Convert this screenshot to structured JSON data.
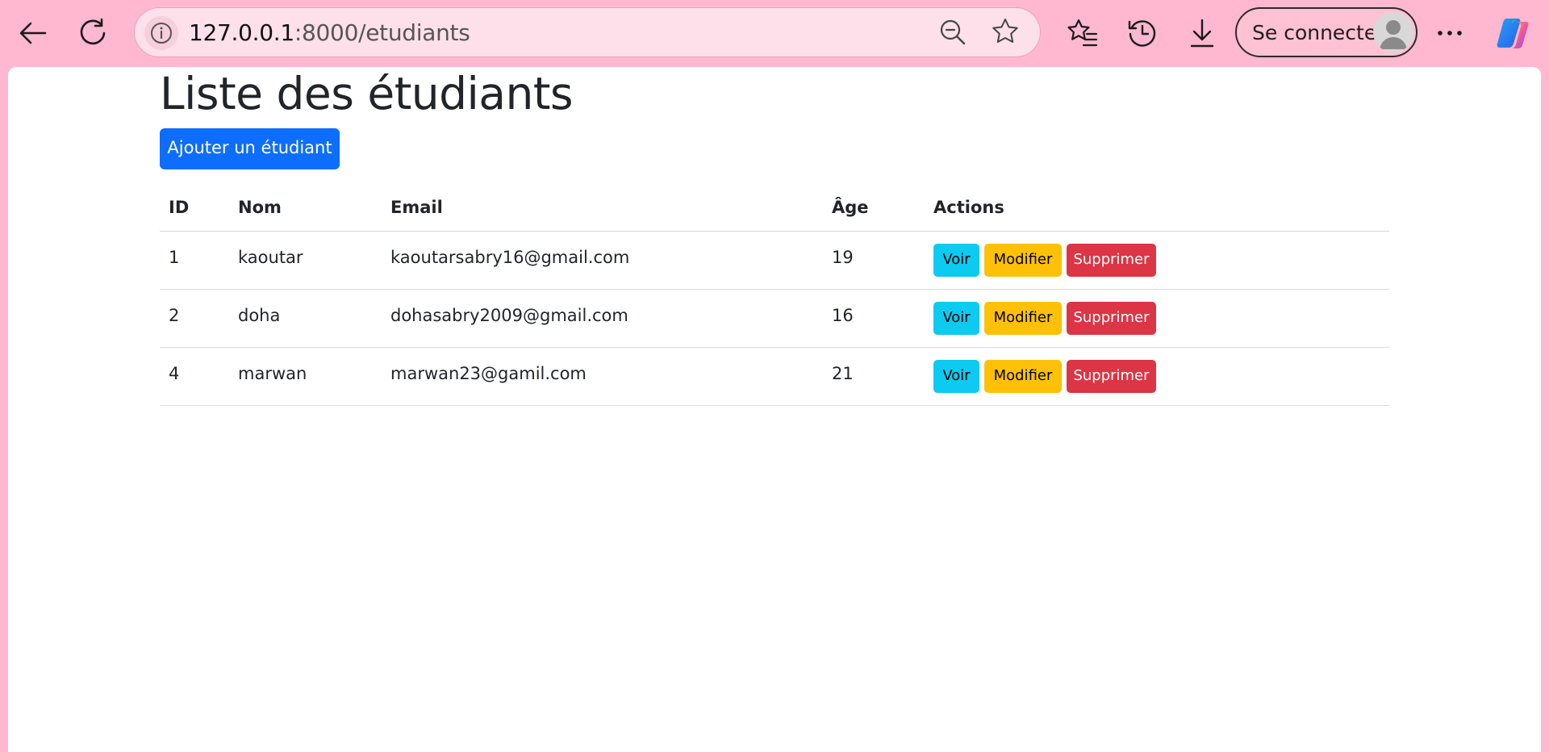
{
  "browser": {
    "url_host": "127.0.0.1",
    "url_rest": ":8000/etudiants",
    "sign_in_label": "Se connecter",
    "icons": [
      "back-icon",
      "refresh-icon",
      "info-icon",
      "zoom-out-icon",
      "favorite-star-icon",
      "favorites-icon",
      "history-icon",
      "download-icon",
      "more-icon",
      "copilot-icon"
    ]
  },
  "page": {
    "title": "Liste des étudiants",
    "add_button": "Ajouter un étudiant"
  },
  "table": {
    "headers": [
      "ID",
      "Nom",
      "Email",
      "Âge",
      "Actions"
    ],
    "rows": [
      {
        "id": "1",
        "nom": "kaoutar",
        "email": "kaoutarsabry16@gmail.com",
        "age": "19"
      },
      {
        "id": "2",
        "nom": "doha",
        "email": "dohasabry2009@gmail.com",
        "age": "16"
      },
      {
        "id": "4",
        "nom": "marwan",
        "email": "marwan23@gamil.com",
        "age": "21"
      }
    ],
    "actions": {
      "view": "Voir",
      "edit": "Modifier",
      "delete": "Supprimer"
    }
  },
  "colors": {
    "browser_bg": "#ffb8cf",
    "primary": "#0d6efd",
    "info": "#0dcaf0",
    "warning": "#ffc107",
    "danger": "#dc3545"
  }
}
